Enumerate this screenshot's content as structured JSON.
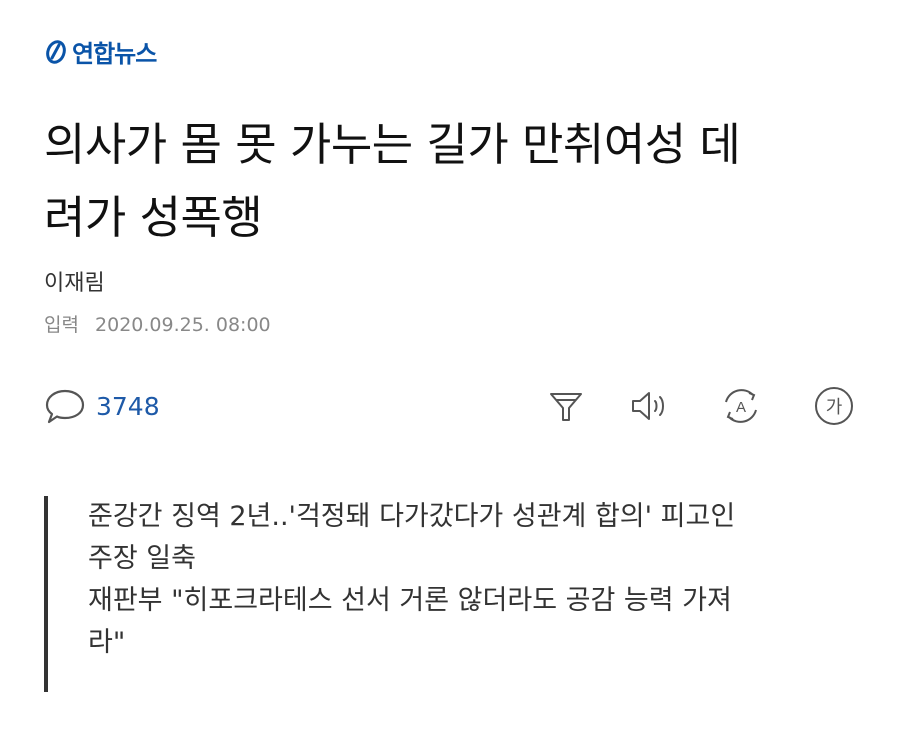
{
  "brand": {
    "name": "연합뉴스",
    "color": "#0a54a8",
    "logo_icon": "yonhap-logo-icon"
  },
  "article": {
    "headline_line1": "의사가 몸 못 가누는 길가 만취여성 데",
    "headline_line2": "려가 성폭행",
    "author": "이재림",
    "date_label": "입력",
    "date_value": "2020.09.25. 08:00"
  },
  "toolbar": {
    "comment_icon": "comment-bubble-icon",
    "comment_count": "3748",
    "comment_color": "#1e5aa8",
    "tools": [
      {
        "name": "filter-icon"
      },
      {
        "name": "speaker-icon"
      },
      {
        "name": "translate-icon"
      },
      {
        "name": "font-size-icon",
        "label": "가"
      }
    ]
  },
  "summary": {
    "line1": "준강간 징역 2년..'걱정돼 다가갔다가 성관계 합의' 피고인",
    "line2": "주장 일축",
    "line3": "재판부 \"히포크라테스 선서 거론 않더라도 공감 능력 가져",
    "line4": "라\""
  }
}
